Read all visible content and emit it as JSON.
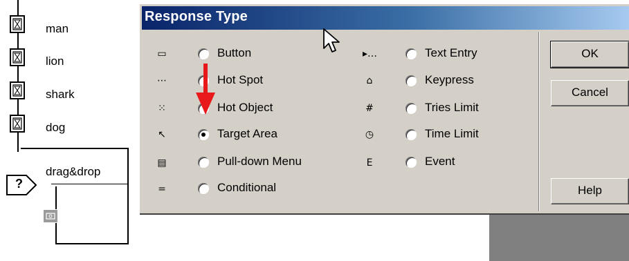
{
  "flowline": {
    "items": [
      {
        "label": "man"
      },
      {
        "label": "lion"
      },
      {
        "label": "shark"
      },
      {
        "label": "dog"
      }
    ],
    "interaction_label": "drag&drop",
    "interaction_symbol": "?"
  },
  "dialog": {
    "title": "Response Type",
    "options_left": [
      {
        "label": "Button",
        "icon": "button-icon",
        "glyph": "▭",
        "selected": false
      },
      {
        "label": "Hot Spot",
        "icon": "hot-spot-icon",
        "glyph": "⋯",
        "selected": false
      },
      {
        "label": "Hot Object",
        "icon": "hot-object-icon",
        "glyph": "⁙",
        "selected": false
      },
      {
        "label": "Target Area",
        "icon": "target-area-icon",
        "glyph": "↖",
        "selected": true
      },
      {
        "label": "Pull-down Menu",
        "icon": "pulldown-menu-icon",
        "glyph": "▤",
        "selected": false
      },
      {
        "label": "Conditional",
        "icon": "conditional-icon",
        "glyph": "=",
        "selected": false
      }
    ],
    "options_right": [
      {
        "label": "Text Entry",
        "icon": "text-entry-icon",
        "glyph": "▸…",
        "selected": false
      },
      {
        "label": "Keypress",
        "icon": "keypress-icon",
        "glyph": "⌂",
        "selected": false
      },
      {
        "label": "Tries Limit",
        "icon": "tries-limit-icon",
        "glyph": "#",
        "selected": false
      },
      {
        "label": "Time Limit",
        "icon": "time-limit-icon",
        "glyph": "◷",
        "selected": false
      },
      {
        "label": "Event",
        "icon": "event-icon",
        "glyph": "E",
        "selected": false
      }
    ],
    "buttons": {
      "ok": "OK",
      "cancel": "Cancel",
      "help": "Help"
    }
  },
  "colors": {
    "titlebar_start": "#0a246a",
    "titlebar_end": "#a6caf0",
    "dialog_bg": "#d4d0c8",
    "annotation_arrow": "#e8191b"
  }
}
